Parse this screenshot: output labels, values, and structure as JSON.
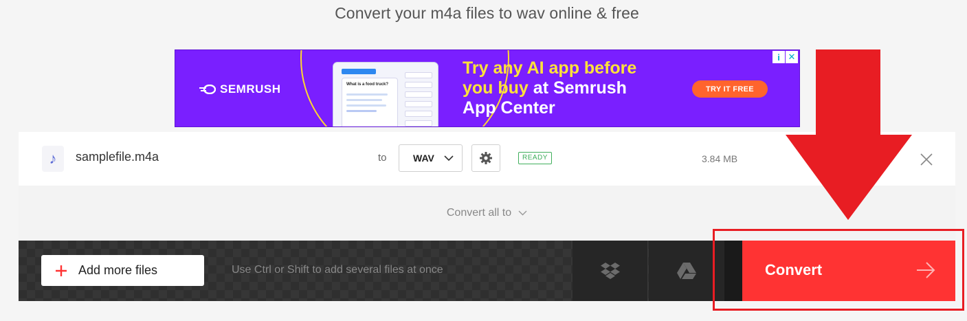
{
  "page": {
    "subtitle": "Convert your m4a files to wav online & free"
  },
  "ad": {
    "brand": "SEMRUSH",
    "headline_highlight": "Try any AI app before you buy",
    "headline_rest_1": " at Semrush",
    "headline_rest_2": "App Center",
    "cta": "TRY IT FREE",
    "info_glyph": "i",
    "close_glyph": "✕",
    "mock": {
      "header": "Compose with AI",
      "question": "What is a food truck?"
    }
  },
  "file": {
    "name": "samplefile.m4a",
    "to_label": "to",
    "format": "WAV",
    "status": "READY",
    "size": "3.84 MB",
    "icon": "music-note-icon"
  },
  "convert_all": {
    "label": "Convert all to"
  },
  "bottom_bar": {
    "add_label": "Add more files",
    "hint": "Use Ctrl or Shift to add several files at once",
    "dropbox_icon": "dropbox-icon",
    "gdrive_icon": "google-drive-icon"
  },
  "convert": {
    "label": "Convert"
  },
  "colors": {
    "accent_red": "#ff3333",
    "annotation_red": "#e81d23",
    "ad_purple": "#7a1fff",
    "ad_yellow": "#ffe23a",
    "ready_green": "#3fae5b"
  }
}
